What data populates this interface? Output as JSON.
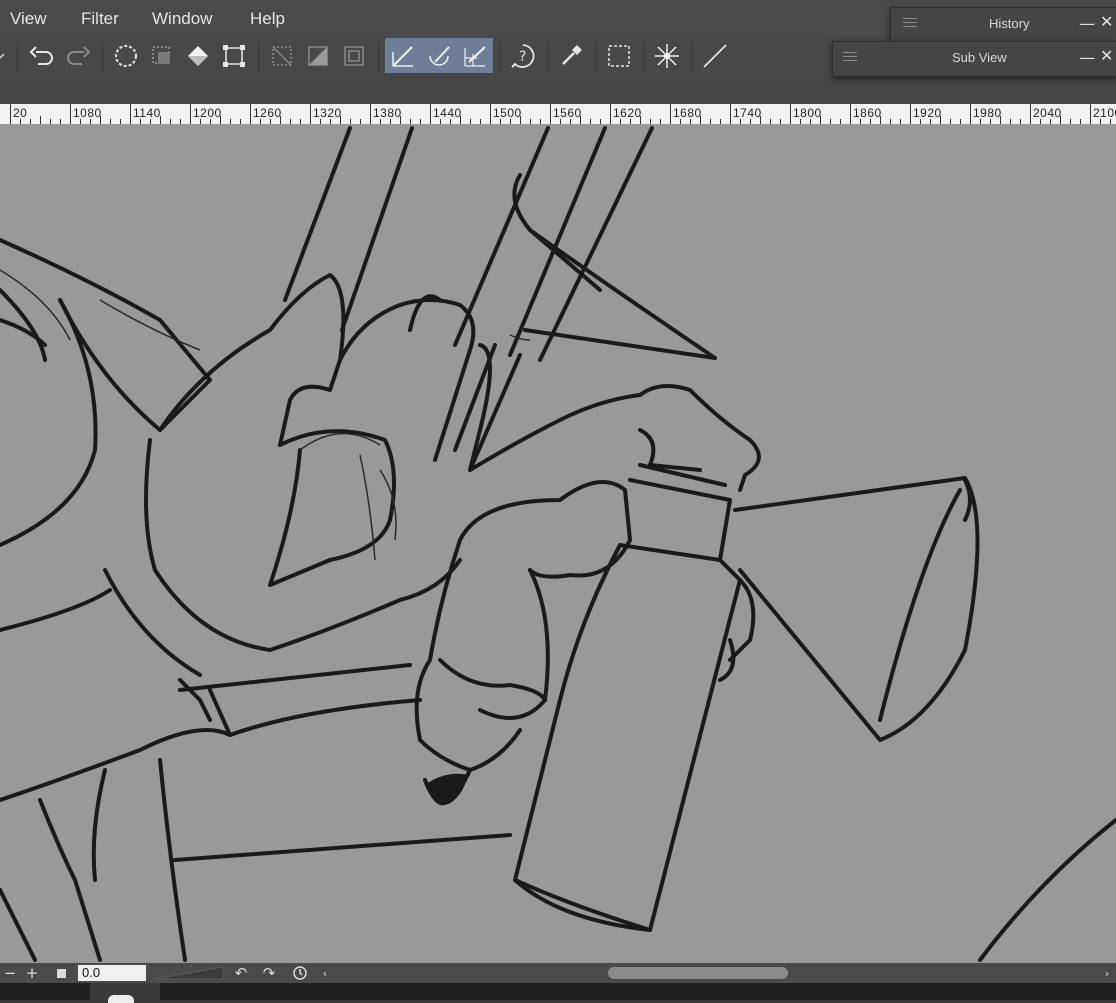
{
  "menu": {
    "items": [
      {
        "label": "View"
      },
      {
        "label": "Filter"
      },
      {
        "label": "Window"
      },
      {
        "label": "Help"
      }
    ]
  },
  "toolbar": {
    "tools": [
      "undo-icon",
      "redo-icon",
      "select-all-icon",
      "deselect-icon",
      "fill-icon",
      "transform-icon",
      "clear-outside-icon",
      "fill-outside-icon",
      "selection-border-icon",
      "snap-to-ruler-icon",
      "snap-to-special-ruler-icon",
      "snap-to-grid-icon",
      "help-icon",
      "eyedropper-icon",
      "selection-icon",
      "sparkle-icon",
      "line-icon"
    ]
  },
  "panels": {
    "history": {
      "title": "History"
    },
    "subview": {
      "title": "Sub View"
    }
  },
  "ruler": {
    "labels": [
      "20",
      "1080",
      "1140",
      "1200",
      "1260",
      "1320",
      "1380",
      "1440",
      "1500",
      "1560",
      "1620",
      "1680",
      "1740",
      "1800",
      "1860",
      "1920",
      "1980",
      "2040",
      "2100"
    ]
  },
  "statusbar": {
    "minus": "−",
    "plus": "+",
    "zoom_value": "0.0"
  },
  "colors": {
    "canvas": "#999999",
    "ink": "#1a1a1a",
    "active_tool": "#6e7e98"
  }
}
